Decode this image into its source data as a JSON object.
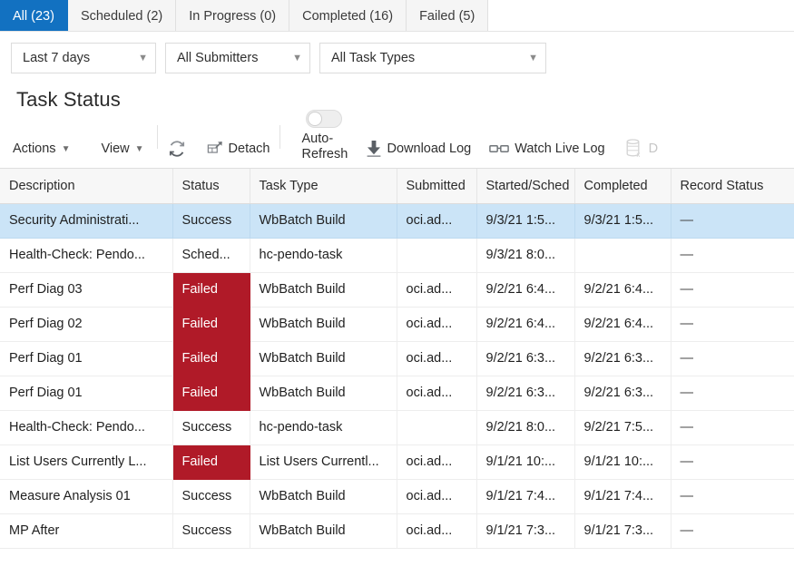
{
  "tabs": [
    {
      "label": "All (23)",
      "active": true
    },
    {
      "label": "Scheduled (2)",
      "active": false
    },
    {
      "label": "In Progress (0)",
      "active": false
    },
    {
      "label": "Completed (16)",
      "active": false
    },
    {
      "label": "Failed (5)",
      "active": false
    }
  ],
  "filters": [
    {
      "value": "Last 7 days",
      "name": "date-range-select"
    },
    {
      "value": "All Submitters",
      "name": "submitter-select"
    },
    {
      "value": "All Task Types",
      "name": "task-type-select"
    }
  ],
  "page": {
    "title": "Task Status"
  },
  "toolbar": {
    "actions_label": "Actions",
    "view_label": "View",
    "caret": "▼",
    "refresh_label": "",
    "detach_label": "Detach",
    "auto_refresh_label": "Auto-Refresh",
    "auto_refresh_on": false,
    "download_log_label": "Download Log",
    "watch_live_log_label": "Watch Live Log",
    "purge_label": "D"
  },
  "table": {
    "columns": [
      "Description",
      "Status",
      "Task Type",
      "Submitted",
      "Started/Sched",
      "Completed",
      "Record Status"
    ],
    "rows": [
      {
        "description": "Security Administrati...",
        "status": "Success",
        "status_failed": false,
        "task_type": "WbBatch Build",
        "submitted": "oci.ad...",
        "started": "9/3/21 1:5...",
        "completed": "9/3/21 1:5...",
        "record_status": "—",
        "selected": true
      },
      {
        "description": "Health-Check: Pendo...",
        "status": "Sched...",
        "status_failed": false,
        "task_type": "hc-pendo-task",
        "submitted": "",
        "started": "9/3/21 8:0...",
        "completed": "",
        "record_status": "—",
        "selected": false
      },
      {
        "description": "Perf Diag 03",
        "status": "Failed",
        "status_failed": true,
        "task_type": "WbBatch Build",
        "submitted": "oci.ad...",
        "started": "9/2/21 6:4...",
        "completed": "9/2/21 6:4...",
        "record_status": "—",
        "selected": false
      },
      {
        "description": "Perf Diag 02",
        "status": "Failed",
        "status_failed": true,
        "task_type": "WbBatch Build",
        "submitted": "oci.ad...",
        "started": "9/2/21 6:4...",
        "completed": "9/2/21 6:4...",
        "record_status": "—",
        "selected": false
      },
      {
        "description": "Perf Diag 01",
        "status": "Failed",
        "status_failed": true,
        "task_type": "WbBatch Build",
        "submitted": "oci.ad...",
        "started": "9/2/21 6:3...",
        "completed": "9/2/21 6:3...",
        "record_status": "—",
        "selected": false
      },
      {
        "description": "Perf Diag 01",
        "status": "Failed",
        "status_failed": true,
        "task_type": "WbBatch Build",
        "submitted": "oci.ad...",
        "started": "9/2/21 6:3...",
        "completed": "9/2/21 6:3...",
        "record_status": "—",
        "selected": false
      },
      {
        "description": "Health-Check: Pendo...",
        "status": "Success",
        "status_failed": false,
        "task_type": "hc-pendo-task",
        "submitted": "",
        "started": "9/2/21 8:0...",
        "completed": "9/2/21 7:5...",
        "record_status": "—",
        "selected": false
      },
      {
        "description": "List Users Currently L...",
        "status": "Failed",
        "status_failed": true,
        "task_type": "List Users Currentl...",
        "submitted": "oci.ad...",
        "started": "9/1/21 10:...",
        "completed": "9/1/21 10:...",
        "record_status": "—",
        "selected": false
      },
      {
        "description": "Measure Analysis 01",
        "status": "Success",
        "status_failed": false,
        "task_type": "WbBatch Build",
        "submitted": "oci.ad...",
        "started": "9/1/21 7:4...",
        "completed": "9/1/21 7:4...",
        "record_status": "—",
        "selected": false
      },
      {
        "description": "MP After",
        "status": "Success",
        "status_failed": false,
        "task_type": "WbBatch Build",
        "submitted": "oci.ad...",
        "started": "9/1/21 7:3...",
        "completed": "9/1/21 7:3...",
        "record_status": "—",
        "selected": false
      }
    ]
  },
  "colors": {
    "accent_blue": "#1271c1",
    "selected_row": "#cbe4f7",
    "failed_red": "#b01a28"
  }
}
